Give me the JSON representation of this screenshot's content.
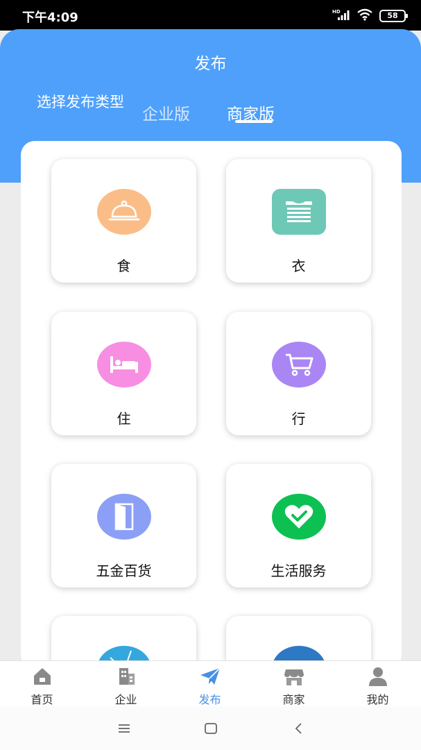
{
  "status_bar": {
    "time": "下午4:09",
    "network": "HD",
    "battery": "58"
  },
  "header": {
    "title": "发布",
    "type_label": "选择发布类型",
    "tabs": [
      {
        "label": "企业版",
        "active": false
      },
      {
        "label": "商家版",
        "active": true
      }
    ]
  },
  "categories": [
    {
      "label": "食",
      "icon": "food-cover-icon",
      "color": "#fbbd88"
    },
    {
      "label": "衣",
      "icon": "clothing-icon",
      "color": "#6ec8b6"
    },
    {
      "label": "住",
      "icon": "bed-icon",
      "color": "#f78ee1"
    },
    {
      "label": "行",
      "icon": "cart-icon",
      "color": "#aa86f4"
    },
    {
      "label": "五金百货",
      "icon": "door-icon",
      "color": "#8c9ff6"
    },
    {
      "label": "生活服务",
      "icon": "heart-icon",
      "color": "#0dc052"
    },
    {
      "label": "",
      "icon": "globe-icon",
      "color": "#34a8de"
    },
    {
      "label": "",
      "icon": "cloud-icon",
      "color": "#2d79c3"
    }
  ],
  "tabbar": [
    {
      "label": "首页",
      "icon": "home-icon",
      "active": false
    },
    {
      "label": "企业",
      "icon": "building-icon",
      "active": false
    },
    {
      "label": "发布",
      "icon": "send-icon",
      "active": true
    },
    {
      "label": "商家",
      "icon": "store-icon",
      "active": false
    },
    {
      "label": "我的",
      "icon": "user-icon",
      "active": false
    }
  ],
  "colors": {
    "accent": "#4ea0fb",
    "active_tab": "#4a90e2"
  }
}
